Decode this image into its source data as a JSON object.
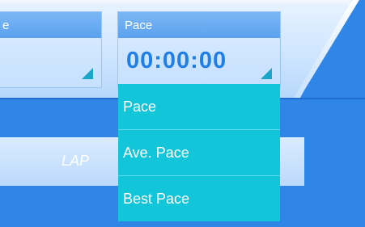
{
  "left_field": {
    "header_label": "e"
  },
  "pace_field": {
    "header_label": "Pace",
    "value": "00:00:00"
  },
  "lap_button": {
    "label": "LAP"
  },
  "dropdown": {
    "items": [
      "Pace",
      "Ave. Pace",
      "Best Pace"
    ]
  },
  "colors": {
    "background": "#2f86e6",
    "accent_value": "#1f7fe6",
    "dropdown_bg": "#12c5d9",
    "corner_triangle": "#1aa6c9"
  }
}
